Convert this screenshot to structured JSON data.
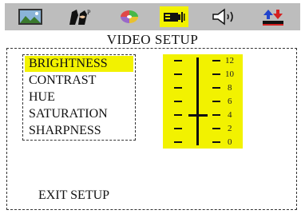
{
  "tabs": [
    {
      "icon": "picture-icon",
      "active": false
    },
    {
      "icon": "characters-icon",
      "active": false
    },
    {
      "icon": "disc-icon",
      "active": false
    },
    {
      "icon": "video-projector-icon",
      "active": true
    },
    {
      "icon": "speaker-icon",
      "active": false
    },
    {
      "icon": "preferences-icon",
      "active": false
    }
  ],
  "screen_title": "VIDEO SETUP",
  "menu": {
    "items": [
      "BRIGHTNESS",
      "CONTRAST",
      "HUE",
      "SATURATION",
      "SHARPNESS"
    ],
    "selected": "BRIGHTNESS"
  },
  "scale": {
    "labels": [
      "12",
      "10",
      "8",
      "6",
      "4",
      "2",
      "0"
    ],
    "value": 4
  },
  "exit_label": "EXIT SETUP",
  "colors": {
    "highlight": "#f2f200",
    "tabbar": "#bdbdbd"
  }
}
